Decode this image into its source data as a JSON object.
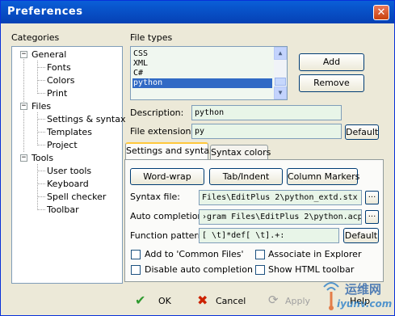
{
  "window": {
    "title": "Preferences"
  },
  "categories": {
    "label": "Categories",
    "tree": [
      {
        "label": "General",
        "children": [
          "Fonts",
          "Colors",
          "Print"
        ]
      },
      {
        "label": "Files",
        "children": [
          "Settings & syntax",
          "Templates",
          "Project"
        ]
      },
      {
        "label": "Tools",
        "children": [
          "User tools",
          "Keyboard",
          "Spell checker",
          "Toolbar"
        ]
      }
    ]
  },
  "file_types": {
    "label": "File types",
    "items": [
      "CSS",
      "XML",
      "C#",
      "python"
    ],
    "selected": "python",
    "add_label": "Add",
    "remove_label": "Remove"
  },
  "description": {
    "label": "Description:",
    "value": "python"
  },
  "file_extensions": {
    "label": "File extensions:",
    "value": "py",
    "default_label": "Default"
  },
  "tabs": [
    {
      "label": "Settings and syntax",
      "active": true
    },
    {
      "label": "Syntax colors",
      "active": false
    }
  ],
  "syntax_panel": {
    "wordwrap_label": "Word-wrap",
    "tabindent_label": "Tab/Indent",
    "columnmarkers_label": "Column Markers",
    "syntax_file_label": "Syntax file:",
    "syntax_file_value": "Files\\EditPlus 2\\python_extd.stx",
    "auto_completion_label": "Auto completion:",
    "auto_completion_value": "›gram Files\\EditPlus 2\\python.acp",
    "function_pattern_label": "Function pattern:",
    "function_pattern_value": "[ \\t]*def[ \\t].+:",
    "function_default_label": "Default",
    "browse_label": "...",
    "checkboxes": [
      {
        "label": "Add to 'Common Files'",
        "checked": false
      },
      {
        "label": "Associate in Explorer",
        "checked": false
      },
      {
        "label": "Disable auto completion",
        "checked": false
      },
      {
        "label": "Show HTML toolbar",
        "checked": false
      }
    ]
  },
  "footer": {
    "ok_label": "OK",
    "cancel_label": "Cancel",
    "apply_label": "Apply",
    "help_label": "Help"
  },
  "watermark": {
    "text": "运维网",
    "sub": "iyunv.com"
  },
  "colors": {
    "title_bar": "#0852c9",
    "selection": "#316ac5",
    "field_bg": "#e8f5e8",
    "ok_check": "#2f9a2f",
    "cancel_x": "#cc2200"
  }
}
